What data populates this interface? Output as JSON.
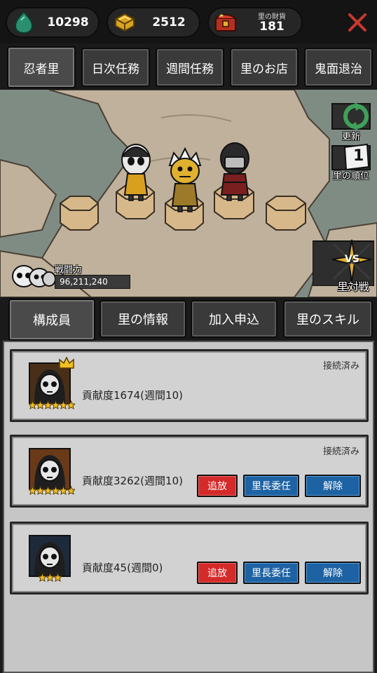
{
  "currency": {
    "gems": "10298",
    "gold": "2512",
    "village_wealth_label": "里の財貨",
    "village_wealth": "181"
  },
  "tabs": [
    "忍者里",
    "日次任務",
    "週間任務",
    "里のお店",
    "鬼面退治"
  ],
  "map": {
    "refresh_label": "更新",
    "rank_label": "里の順位",
    "rank_number": "1",
    "versus_label": "里対戦",
    "versus_badge": "VS",
    "power_label": "戦闘力",
    "power_value": "96,211,240"
  },
  "subtabs": [
    "構成員",
    "里の情報",
    "加入申込",
    "里のスキル"
  ],
  "members": [
    {
      "status": "接続済み",
      "contribution": "貢献度1674(週間10)",
      "stars": 6,
      "leader": true
    },
    {
      "status": "接続済み",
      "contribution": "貢献度3262(週間10)",
      "stars": 6,
      "leader": false,
      "kick": "追放",
      "delegate": "里長委任",
      "dismiss": "解除"
    },
    {
      "status": "",
      "contribution": "貢献度45(週間0)",
      "stars": 3,
      "leader": false,
      "kick": "追放",
      "delegate": "里長委任",
      "dismiss": "解除"
    }
  ],
  "colors": {
    "accent_red": "#d42a2a",
    "accent_blue": "#1d62a3",
    "close_red": "#c8382e"
  },
  "icons": [
    "gem-icon",
    "gold-icon",
    "treasure-chest-icon",
    "close-icon",
    "refresh-icon",
    "rank-icon",
    "versus-icon",
    "skull-icon",
    "crown-icon",
    "star-icon"
  ]
}
